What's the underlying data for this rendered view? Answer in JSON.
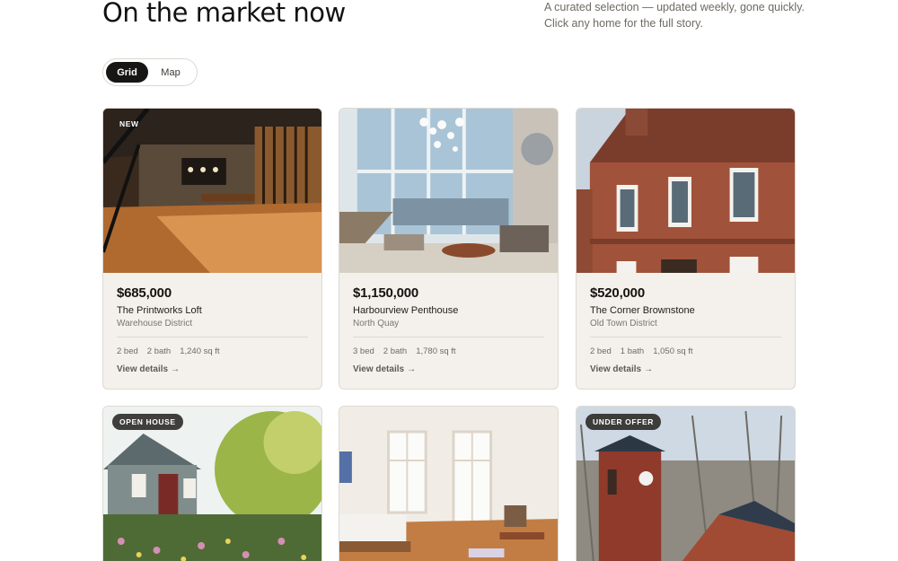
{
  "header": {
    "title": "On the market now",
    "intro_line1": "A curated selection — updated weekly, gone quickly.",
    "intro_line2": "Click any home for the full story."
  },
  "view_toggle": {
    "options": [
      "Grid",
      "Map"
    ],
    "selected": "Grid"
  },
  "details_label": "View details",
  "arrow_glyph": "→",
  "listings": [
    {
      "badge": "NEW",
      "price": "$685,000",
      "title": "The Printworks Loft",
      "area": "Warehouse District",
      "beds": "2 bed",
      "baths": "2 bath",
      "size": "1,240 sq ft"
    },
    {
      "badge": "",
      "price": "$1,150,000",
      "title": "Harbourview Penthouse",
      "area": "North Quay",
      "beds": "3 bed",
      "baths": "2 bath",
      "size": "1,780 sq ft"
    },
    {
      "badge": "",
      "price": "$520,000",
      "title": "The Corner Brownstone",
      "area": "Old Town District",
      "beds": "2 bed",
      "baths": "1 bath",
      "size": "1,050 sq ft"
    },
    {
      "badge": "OPEN HOUSE"
    },
    {
      "badge": ""
    },
    {
      "badge": "UNDER OFFER"
    }
  ],
  "colors": {
    "accent_dark": "#171614",
    "card_bg": "#f4f1ec",
    "muted_text": "#6e6a64"
  }
}
